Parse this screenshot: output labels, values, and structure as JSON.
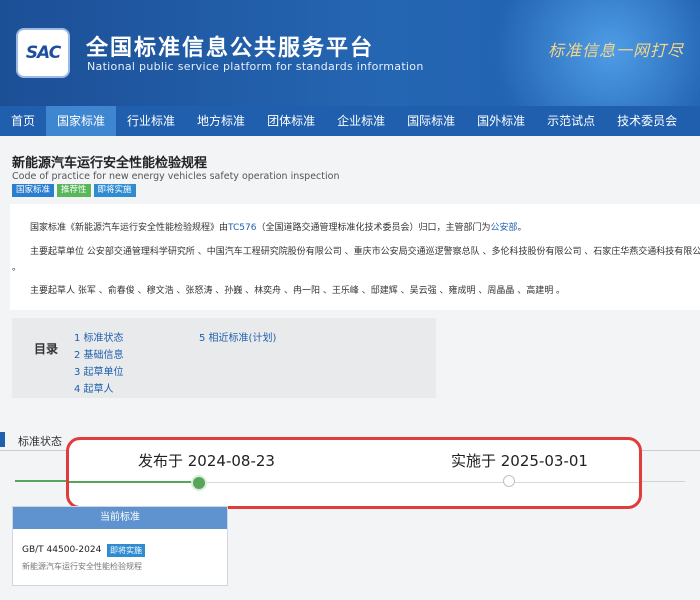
{
  "header": {
    "logo_text": "SAC",
    "site_title": "全国标准信息公共服务平台",
    "site_subtitle": "National public service platform  for standards information",
    "slogan": "标准信息一网打尽"
  },
  "nav": {
    "items": [
      "首页",
      "国家标准",
      "行业标准",
      "地方标准",
      "团体标准",
      "企业标准",
      "国际标准",
      "国外标准",
      "示范试点",
      "技术委员会"
    ],
    "active_index": 1
  },
  "standard": {
    "title_cn": "新能源汽车运行安全性能检验规程",
    "title_en": "Code of practice for new energy vehicles safety operation inspection",
    "badges": [
      "国家标准",
      "推荐性",
      "即将实施"
    ]
  },
  "info": {
    "line1_prefix": "国家标准《新能源汽车运行安全性能检验规程》由",
    "line1_tc": "TC576",
    "line1_mid": "（全国道路交通管理标准化技术委员会）归口，主管部门为",
    "line1_dept": "公安部",
    "line1_end": "。",
    "drafting_units": "主要起草单位 公安部交通管理科学研究所 、中国汽车工程研究院股份有限公司 、重庆市公安局交通巡逻警察总队 、多伦科技股份有限公司 、石家庄华燕交通科技有限公司",
    "drafting_units_end": "。",
    "drafters": "主要起草人 张军 、俞春俊 、穆文浩 、张怒涛 、孙巍 、林奕舟 、冉一阳 、王乐峰 、邸建辉 、吴云强 、雍成明 、周晶晶 、高建明 。"
  },
  "toc": {
    "label": "目录",
    "items": [
      "1  标准状态",
      "2  基础信息",
      "3  起草单位",
      "4  起草人",
      "5  相近标准(计划)"
    ]
  },
  "status_section": {
    "title": "标准状态"
  },
  "timeline": {
    "published": "发布于 2024-08-23",
    "implemented": "实施于 2025-03-01"
  },
  "current_card": {
    "header": "当前标准",
    "code": "GB/T 44500-2024",
    "badge": "即将实施",
    "name": "新能源汽车运行安全性能检验规程"
  },
  "colors": {
    "header_blue": "#1f5fae",
    "highlight_border": "#e23b3b",
    "progress_green": "#5aa35a"
  }
}
